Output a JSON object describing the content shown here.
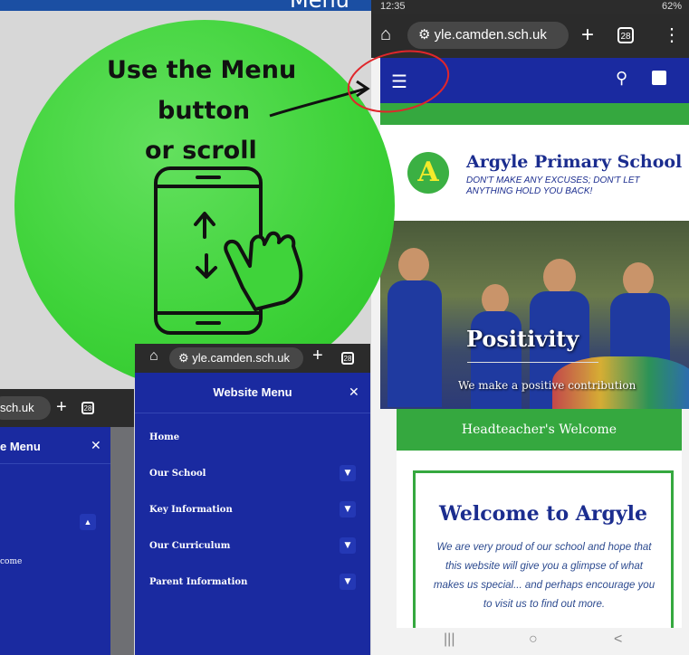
{
  "banner": {
    "text": "Menu"
  },
  "bubble": {
    "line1": "Use the Menu",
    "line2": "button",
    "line3": "or scroll"
  },
  "phone_right": {
    "status": {
      "time": "12:35",
      "battery": "62%"
    },
    "browser": {
      "url": "yle.camden.sch.uk",
      "tab_count": "28"
    },
    "school": {
      "name": "Argyle Primary School",
      "logo_letter": "A",
      "tagline": "DON'T MAKE ANY EXCUSES; DON'T LET ANYTHING HOLD YOU BACK!"
    },
    "hero": {
      "title": "Positivity",
      "subtitle": "We make a positive contribution"
    },
    "headteacher_link": "Headteacher's Welcome",
    "welcome": {
      "title": "Welcome to Argyle",
      "text": "We are very proud of our school and hope that this website will give you a glimpse of what makes us special... and perhaps encourage you to visit us to find out more."
    },
    "bottom_nav": [
      "|||",
      "○",
      "<"
    ]
  },
  "phone_middle": {
    "browser": {
      "url": "yle.camden.sch.uk",
      "tab_count": "28"
    },
    "menu_title": "Website Menu",
    "items": [
      {
        "label": "Home",
        "has_submenu": false
      },
      {
        "label": "Our School",
        "has_submenu": true
      },
      {
        "label": "Key Information",
        "has_submenu": true
      },
      {
        "label": "Our Curriculum",
        "has_submenu": true
      },
      {
        "label": "Parent Information",
        "has_submenu": true
      }
    ]
  },
  "phone_left": {
    "browser": {
      "url": "sch.uk",
      "tab_count": "28"
    },
    "menu_title": "e Menu",
    "submenu_item": "come"
  },
  "colors": {
    "brand_blue": "#1a2aa0",
    "brand_green": "#35a83f",
    "bubble_green": "#3fd33a",
    "annotation_red": "#e0262b"
  },
  "icons": [
    "home-icon",
    "tune-icon",
    "plus-icon",
    "tabs-icon",
    "more-icon",
    "hamburger-icon",
    "search-icon",
    "translate-icon",
    "close-icon",
    "chevron-down-icon",
    "chevron-up-icon",
    "phone-scroll-icon",
    "arrow-icon"
  ]
}
